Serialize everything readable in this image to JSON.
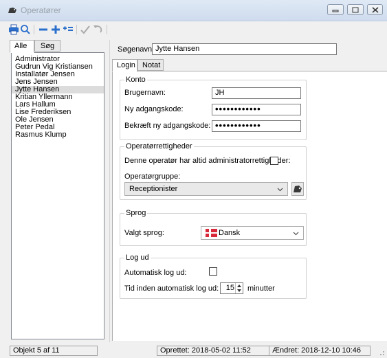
{
  "window": {
    "title": "Operatører"
  },
  "left_tabs": [
    "Alle",
    "Søg"
  ],
  "operators": [
    "Administrator",
    "Gudrun Vig Kristiansen",
    "Installatør Jensen",
    "Jens Jensen",
    "Jytte Hansen",
    "Kritian Yllermann",
    "Lars Hallum",
    "Lise Frederiksen",
    "Ole Jensen",
    "Peter Pedal",
    "Rasmus Klump"
  ],
  "selected_operator_index": 4,
  "search_name": {
    "label": "Søgenavn:",
    "value": "Jytte Hansen"
  },
  "inner_tabs": [
    "Login",
    "Notat"
  ],
  "konto": {
    "title": "Konto",
    "username_label": "Brugernavn:",
    "username_value": "JH",
    "new_password_label": "Ny adgangskode:",
    "new_password_value": "••••••••••••",
    "confirm_password_label": "Bekræft ny adgangskode:",
    "confirm_password_value": "••••••••••••"
  },
  "rights": {
    "title": "Operatørrettigheder",
    "admin_label": "Denne operatør har altid administratorrettigheder:",
    "admin_checked": false,
    "group_label": "Operatørgruppe:",
    "group_value": "Receptionister"
  },
  "language": {
    "title": "Sprog",
    "label": "Valgt sprog:",
    "value": "Dansk"
  },
  "logout": {
    "title": "Log ud",
    "auto_label": "Automatisk log ud:",
    "auto_checked": false,
    "timeout_label": "Tid inden automatisk log ud:",
    "timeout_value": "15",
    "timeout_unit": "minutter"
  },
  "status": {
    "record": "Objekt 5 af 11",
    "created": "Oprettet: 2018-05-02  11:52",
    "changed": "Ændret: 2018-12-10  10:46"
  },
  "icons": {
    "print": "print-icon",
    "search": "search-icon",
    "remove": "minus-icon",
    "add": "plus-icon",
    "add_multiple": "add-multiple-icon",
    "save": "checkmark-icon",
    "undo": "undo-icon",
    "group": "group-icon"
  }
}
